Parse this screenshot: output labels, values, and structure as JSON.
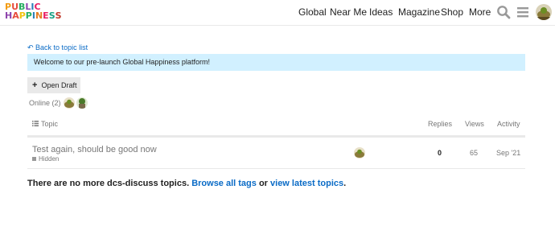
{
  "header": {
    "logo": {
      "line1": "PUBLIC",
      "line2": "HAPPINESS"
    },
    "nav": [
      "Global",
      "Near Me",
      "Ideas",
      "Magazine",
      "Shop",
      "More"
    ],
    "icons": [
      "search-icon",
      "hamburger-menu-icon",
      "user-avatar"
    ]
  },
  "back_link": "Back to topic list",
  "banner": "Welcome to our pre-launch Global Happiness platform!",
  "draft_button": "Open Draft",
  "online": "Online (2)",
  "table": {
    "columns": {
      "topic": "Topic",
      "replies": "Replies",
      "views": "Views",
      "activity": "Activity"
    },
    "rows": [
      {
        "title": "Test again, should be good now",
        "tag": "Hidden",
        "replies": "0",
        "views": "65",
        "activity": "Sep '21"
      }
    ]
  },
  "footer": {
    "prefix": "There are no more dcs-discuss topics.",
    "browse_link": "Browse all tags",
    "or_text": "or",
    "latest_link": "view latest topics",
    "suffix": "."
  },
  "colors": {
    "link": "#0a6bc6",
    "banner_bg": "#d1f0ff",
    "muted": "#777777"
  }
}
